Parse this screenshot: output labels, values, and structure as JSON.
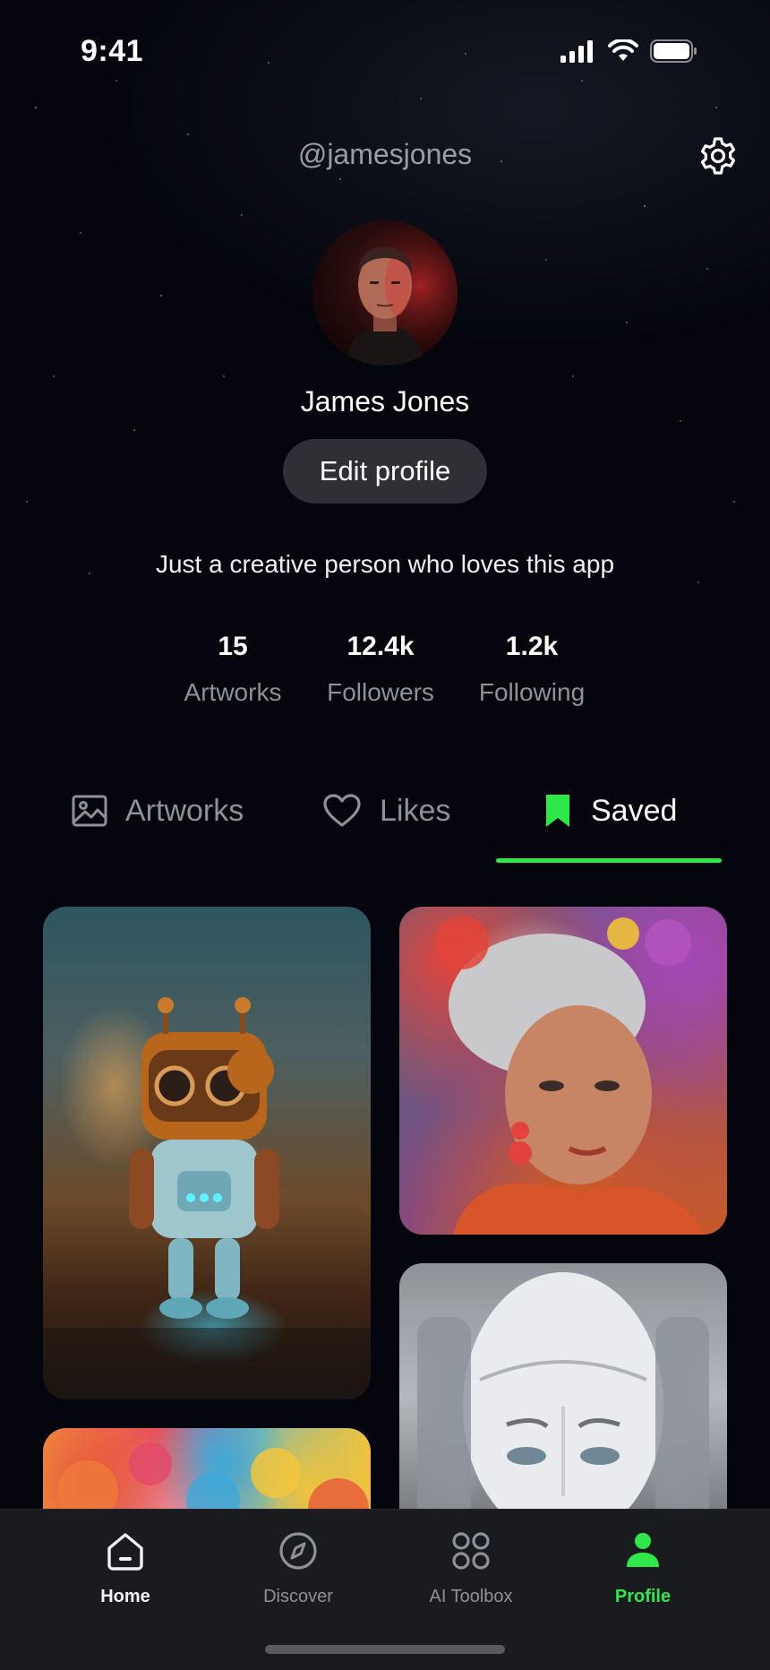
{
  "status_bar": {
    "time": "9:41"
  },
  "header": {
    "handle": "@jamesjones"
  },
  "profile": {
    "name": "James Jones",
    "edit_label": "Edit profile",
    "bio": "Just a creative person who loves this app"
  },
  "stats": [
    {
      "value": "15",
      "label": "Artworks"
    },
    {
      "value": "12.4k",
      "label": "Followers"
    },
    {
      "value": "1.2k",
      "label": "Following"
    }
  ],
  "tabs": [
    {
      "label": "Artworks",
      "icon": "image-icon",
      "active": false
    },
    {
      "label": "Likes",
      "icon": "heart-icon",
      "active": false
    },
    {
      "label": "Saved",
      "icon": "bookmark-icon",
      "active": true
    }
  ],
  "bottom_nav": [
    {
      "label": "Home",
      "icon": "home-icon"
    },
    {
      "label": "Discover",
      "icon": "compass-icon"
    },
    {
      "label": "AI Toolbox",
      "icon": "grid-icon"
    },
    {
      "label": "Profile",
      "icon": "person-icon",
      "active": true
    }
  ],
  "colors": {
    "accent": "#2ee84a",
    "background": "#05060d",
    "nav_background": "#1a1b1f"
  }
}
